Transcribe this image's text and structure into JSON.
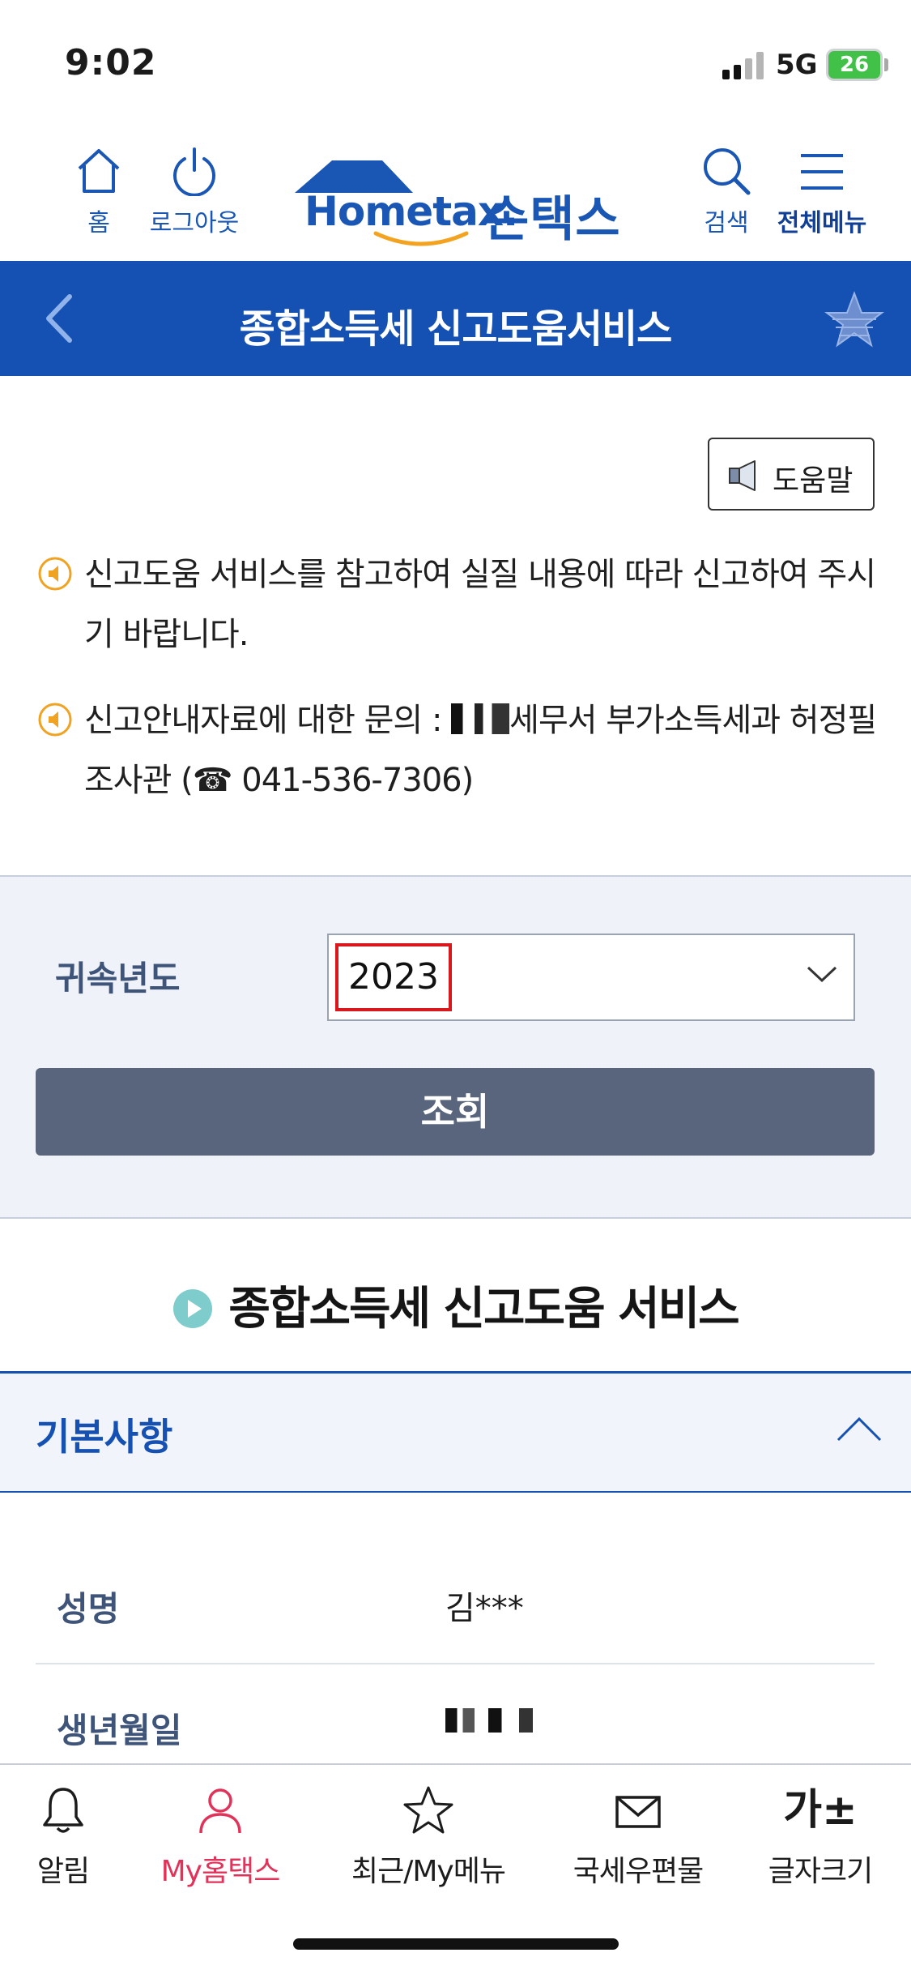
{
  "status_bar": {
    "time": "9:02",
    "network": "5G",
    "battery": "26"
  },
  "top_nav": {
    "home_label": "홈",
    "logout_label": "로그아웃",
    "logo_word": "Hometax.",
    "logo_kr": "손택스",
    "search_label": "검색",
    "menu_label": "전체메뉴"
  },
  "title_bar": {
    "title": "종합소득세 신고도움서비스"
  },
  "help": {
    "label": "도움말"
  },
  "notices": {
    "first": "신고도움 서비스를 참고하여 실질 내용에 따라 신고하여 주시기 바랍니다.",
    "second_prefix": "신고안내자료에 대한 문의 : ",
    "second_suffix": "세무서 부가소득세과 허정필 조사관 (☎ 041-536-7306)"
  },
  "search": {
    "year_label": "귀속년도",
    "year_value": "2023",
    "query_button": "조회"
  },
  "service": {
    "heading": "종합소득세 신고도움 서비스",
    "section_title": "기본사항",
    "rows": [
      {
        "key": "성명",
        "value": "김***"
      },
      {
        "key": "생년월일",
        "value": ""
      }
    ]
  },
  "tab_bar": {
    "items": [
      {
        "label": "알림"
      },
      {
        "label": "My홈택스"
      },
      {
        "label": "최근/My메뉴"
      },
      {
        "label": "국세우편물"
      },
      {
        "label": "글자크기",
        "glyph": "가±"
      }
    ]
  },
  "colors": {
    "brand_blue": "#1550b3",
    "button_gray": "#58657d",
    "accent_pink": "#e1335a",
    "notice_orange": "#f0a323",
    "highlight_red": "#d8181c"
  }
}
